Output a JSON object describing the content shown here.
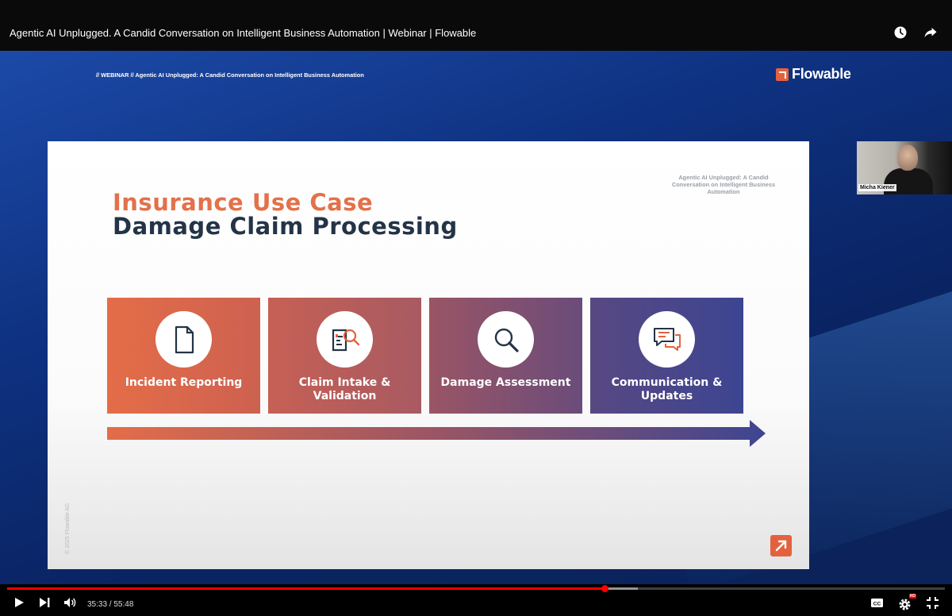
{
  "header": {
    "title": "Agentic AI Unplugged. A Candid Conversation on Intelligent Business Automation | Webinar | Flowable",
    "icons": [
      "watch-later-icon",
      "share-icon"
    ]
  },
  "video": {
    "webinar_line": "// WEBINAR // Agentic AI Unplugged: A Candid Conversation on Intelligent Business Automation",
    "brand": "Flowable",
    "slide": {
      "tag": "Agentic AI Unplugged: A Candid Conversation on Intelligent Business Automation",
      "title_line1": "Insurance Use Case",
      "title_line2": "Damage Claim Processing",
      "steps": [
        {
          "label": "Incident Reporting",
          "icon": "document-icon"
        },
        {
          "label": "Claim Intake & Validation",
          "icon": "document-search-icon"
        },
        {
          "label": "Damage Assessment",
          "icon": "magnifier-icon"
        },
        {
          "label": "Communication & Updates",
          "icon": "chat-bubbles-icon"
        }
      ],
      "copyright": "© 2025 Flowable AG"
    },
    "speaker": {
      "name": "Micha Kiener"
    },
    "colors": {
      "accent": "#e3623e",
      "navy": "#243447",
      "progress": "#ff0000"
    }
  },
  "controls": {
    "time": "35:33 / 55:48",
    "progress_fraction": 0.637,
    "buffer_fraction": 0.673,
    "hd_badge": "HD",
    "icons_left": [
      "play-icon",
      "next-icon",
      "volume-icon"
    ],
    "icons_right": [
      "captions-icon",
      "settings-icon",
      "exit-fullscreen-icon"
    ]
  }
}
